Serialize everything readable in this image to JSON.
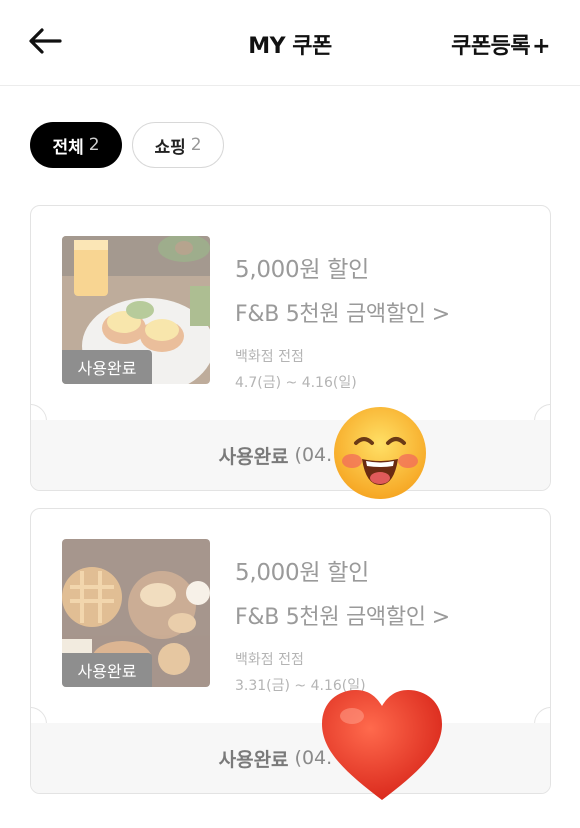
{
  "header": {
    "title": "MY 쿠폰",
    "register_label": "쿠폰등록",
    "register_plus": "+"
  },
  "filters": [
    {
      "label": "전체",
      "count": "2"
    },
    {
      "label": "쇼핑",
      "count": "2"
    }
  ],
  "coupons": [
    {
      "amount": "5,000원 할인",
      "name": "F&B 5천원 금액할인",
      "chevron": ">",
      "place": "백화점 전점",
      "period": "4.7(금) ~ 4.16(일)",
      "badge": "사용완료",
      "status_label": "사용완료",
      "status_date": "(04. 11"
    },
    {
      "amount": "5,000원 할인",
      "name": "F&B 5천원 금액할인",
      "chevron": ">",
      "place": "백화점 전점",
      "period": "3.31(금) ~ 4.16(일)",
      "badge": "사용완료",
      "status_label": "사용완료",
      "status_date": "(04. 11"
    }
  ],
  "colors": {
    "active_chip": "#000000",
    "badge": "#8e8e8e",
    "muted_text": "#9a9a9a"
  },
  "icons": [
    "back-arrow-icon",
    "chevron-right-icon",
    "smiley-sticker-icon",
    "heart-sticker-icon"
  ]
}
